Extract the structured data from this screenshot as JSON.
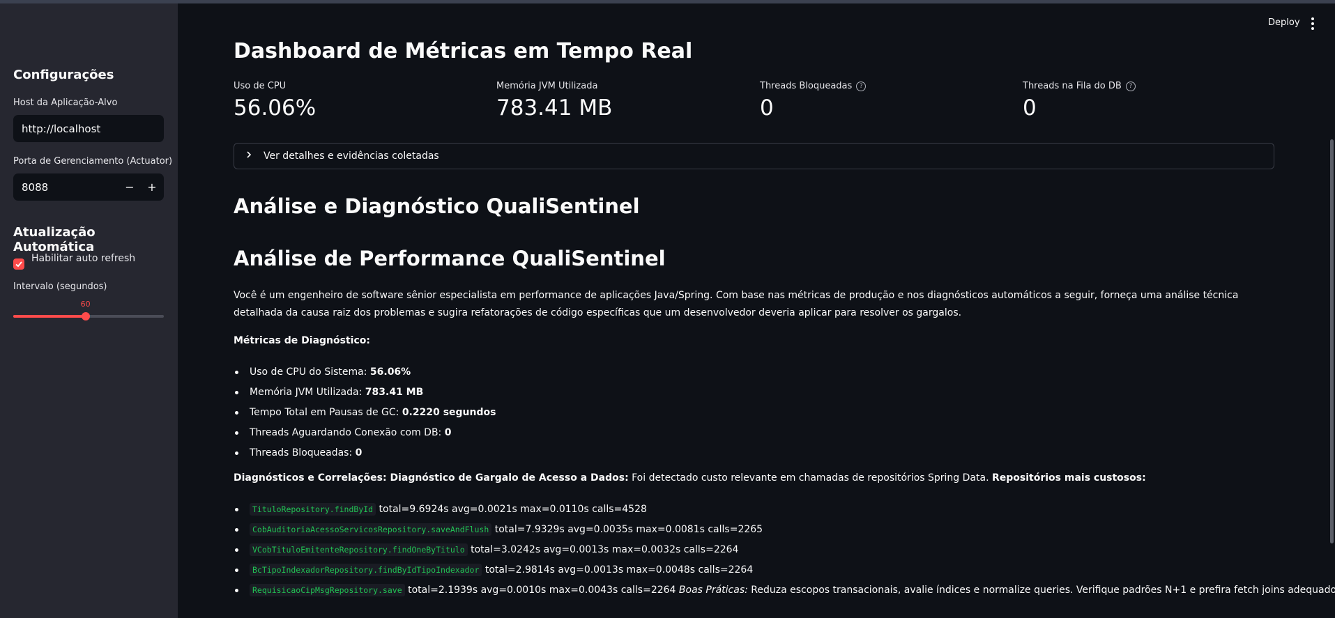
{
  "header": {
    "deploy_label": "Deploy"
  },
  "sidebar": {
    "title": "Configurações",
    "host_label": "Host da Aplicação-Alvo",
    "host_value": "http://localhost",
    "port_label": "Porta de Gerenciamento (Actuator)",
    "port_value": "8088",
    "port_minus": "−",
    "port_plus": "+",
    "auto_title": "Atualização Automática",
    "auto_refresh_label": "Habilitar auto refresh",
    "auto_refresh_checked": true,
    "interval_label": "Intervalo (segundos)",
    "interval_value": "60",
    "interval_fraction": 0.48
  },
  "main": {
    "title": "Dashboard de Métricas em Tempo Real",
    "metrics": [
      {
        "label": "Uso de CPU",
        "value": "56.06%",
        "help": false
      },
      {
        "label": "Memória JVM Utilizada",
        "value": "783.41 MB",
        "help": false
      },
      {
        "label": "Threads Bloqueadas",
        "value": "0",
        "help": true
      },
      {
        "label": "Threads na Fila do DB",
        "value": "0",
        "help": true
      }
    ],
    "expander_label": "Ver detalhes e evidências coletadas",
    "heading_diag": "Análise e Diagnóstico QualiSentinel",
    "heading_perf": "Análise de Performance QualiSentinel",
    "intro": "Você é um engenheiro de software sênior especialista em performance de aplicações Java/Spring. Com base nas métricas de produção e nos diagnósticos automáticos a seguir, forneça uma análise técnica detalhada da causa raiz dos problemas e sugira refatorações de código específicas que um desenvolvedor deveria aplicar para resolver os gargalos.",
    "metrics_heading": "Métricas de Diagnóstico:",
    "diag_metrics": [
      {
        "label": "Uso de CPU do Sistema: ",
        "value": "56.06%"
      },
      {
        "label": "Memória JVM Utilizada: ",
        "value": "783.41 MB"
      },
      {
        "label": "Tempo Total em Pausas de GC: ",
        "value": "0.2220 segundos"
      },
      {
        "label": "Threads Aguardando Conexão com DB: ",
        "value": "0"
      },
      {
        "label": "Threads Bloqueadas: ",
        "value": "0"
      }
    ],
    "diag_prefix": "Diagnósticos e Correlações: Diagnóstico de Gargalo de Acesso a Dados:",
    "diag_text": " Foi detectado custo relevante em chamadas de repositórios Spring Data. ",
    "diag_suffix": "Repositórios mais custosos:",
    "repos": [
      {
        "name": "TituloRepository.findById",
        "stats": " total=9.6924s avg=0.0021s max=0.0110s calls=4528"
      },
      {
        "name": "CobAuditoriaAcessoServicosRepository.saveAndFlush",
        "stats": " total=7.9329s avg=0.0035s max=0.0081s calls=2265"
      },
      {
        "name": "VCobTituloEmitenteRepository.findOneByTitulo",
        "stats": " total=3.0242s avg=0.0013s max=0.0032s calls=2264"
      },
      {
        "name": "BcTipoIndexadorRepository.findByIdTipoIndexador",
        "stats": " total=2.9814s avg=0.0013s max=0.0048s calls=2264"
      },
      {
        "name": "RequisicaoCipMsgRepository.save",
        "stats": " total=2.1939s avg=0.0010s max=0.0043s calls=2264 "
      }
    ],
    "best_practices_label": "Boas Práticas:",
    "best_practices_text": " Reduza escopos transacionais, avalie índices e normalize queries. Verifique padrões N+1 e prefira fetch joins adequados."
  },
  "colors": {
    "accent": "#ff4b4b",
    "code": "#21c354",
    "background": "#0e1117",
    "sidebar": "#262730"
  }
}
